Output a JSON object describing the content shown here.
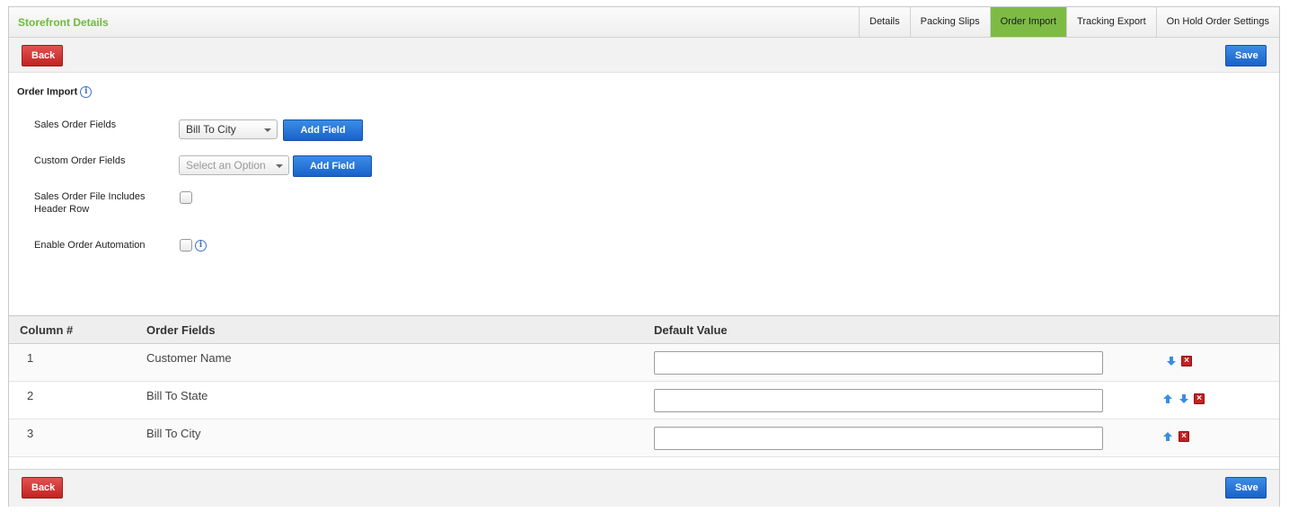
{
  "header": {
    "title": "Storefront Details",
    "tabs": [
      {
        "label": "Details",
        "active": false
      },
      {
        "label": "Packing Slips",
        "active": false
      },
      {
        "label": "Order Import",
        "active": true
      },
      {
        "label": "Tracking Export",
        "active": false
      },
      {
        "label": "On Hold Order Settings",
        "active": false
      }
    ]
  },
  "toolbar": {
    "back_label": "Back",
    "save_label": "Save"
  },
  "form": {
    "section_title": "Order Import",
    "info_icon": "info-icon",
    "sales_order_fields": {
      "label": "Sales Order Fields",
      "selected": "Bill To City",
      "button": "Add Field"
    },
    "custom_order_fields": {
      "label": "Custom Order Fields",
      "placeholder": "Select an Option",
      "button": "Add Field"
    },
    "header_row": {
      "label_line1": "Sales Order File Includes",
      "label_line2": "Header Row",
      "checked": false
    },
    "automation": {
      "label": "Enable Order Automation",
      "checked": false
    }
  },
  "table": {
    "columns": [
      "Column #",
      "Order Fields",
      "Default Value"
    ],
    "rows": [
      {
        "num": "1",
        "field": "Customer Name",
        "value": "",
        "up": false,
        "down": true
      },
      {
        "num": "2",
        "field": "Bill To State",
        "value": "",
        "up": true,
        "down": true
      },
      {
        "num": "3",
        "field": "Bill To City",
        "value": "",
        "up": true,
        "down": false
      }
    ]
  },
  "footer": {
    "back_label": "Back",
    "save_label": "Save"
  },
  "colors": {
    "brand_green": "#6fba3c",
    "active_tab": "#7dbb45",
    "primary_blue": "#1a62c9",
    "danger_red": "#c32222"
  }
}
